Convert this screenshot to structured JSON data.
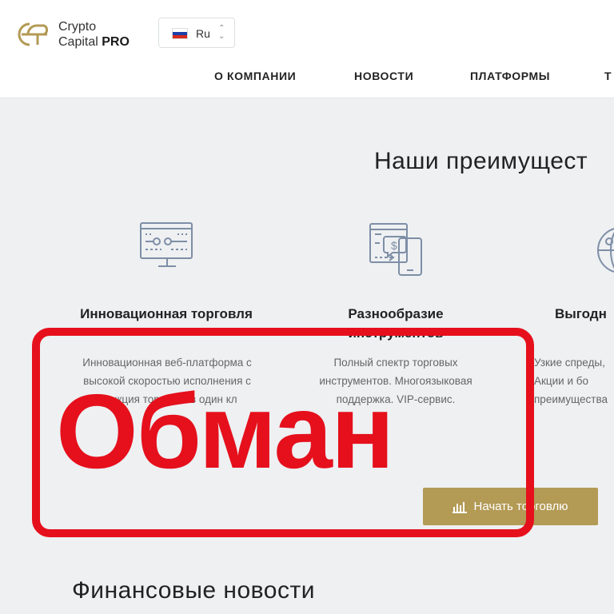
{
  "brand": {
    "line1": "Crypto",
    "line2_prefix": "Capital ",
    "line2_bold": "PRO"
  },
  "language": {
    "selected": "Ru"
  },
  "nav": [
    {
      "label": "О КОМПАНИИ"
    },
    {
      "label": "НОВОСТИ"
    },
    {
      "label": "ПЛАТФОРМЫ"
    },
    {
      "label": "Т"
    }
  ],
  "advantages": {
    "title": "Наши преимущест",
    "items": [
      {
        "icon": "trading-monitor-icon",
        "title": "Инновационная торговля",
        "description": "Инновационная веб-платформа с высокой скоростью исполнения с функция торговли в один кл"
      },
      {
        "icon": "instruments-payment-icon",
        "title": "Разнообразие инструментов",
        "description": "Полный спектр торговых инструментов. Многоязыковая поддержка. VIP-сервис."
      },
      {
        "icon": "globe-icon",
        "title": "Выгодн",
        "description": "Узкие спреды, Акции и бо преимущества"
      }
    ],
    "cta_label": "Начать торговлю"
  },
  "overlay": {
    "stamp_text": "Обман"
  },
  "news": {
    "title": "Финансовые новости"
  },
  "colors": {
    "gold": "#b39a55",
    "stamp_red": "#e5101c",
    "background": "#eef0f2"
  }
}
